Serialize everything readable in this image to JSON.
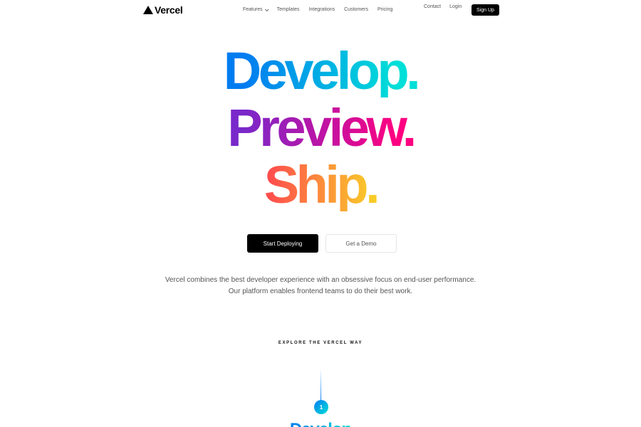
{
  "brand": {
    "name": "Vercel",
    "logo_icon": "triangle-logo-icon"
  },
  "nav": {
    "links": [
      "Features",
      "Templates",
      "Integrations",
      "Customers",
      "Pricing"
    ],
    "features_icon": "chevron-down-icon",
    "right_links": [
      "Contact",
      "Login"
    ],
    "signup_label": "Sign Up"
  },
  "hero": {
    "line1": "Develop.",
    "line2": "Preview.",
    "line3": "Ship."
  },
  "cta": {
    "primary_label": "Start Deploying",
    "secondary_label": "Get a Demo"
  },
  "description": {
    "line1": "Vercel combines the best developer experience with an obsessive focus on end-user performance.",
    "line2": "Our platform enables frontend teams to do their best work."
  },
  "explore": {
    "heading": "EXPLORE THE VERCEL WAY",
    "step_number": "1",
    "step_title": "Develop"
  },
  "colors": {
    "develop_gradient": [
      "#007cf0",
      "#00dfd8"
    ],
    "preview_gradient": [
      "#7928ca",
      "#ff0080"
    ],
    "ship_gradient": [
      "#ff4d4d",
      "#f9cb28"
    ],
    "primary_button": "#000000"
  }
}
